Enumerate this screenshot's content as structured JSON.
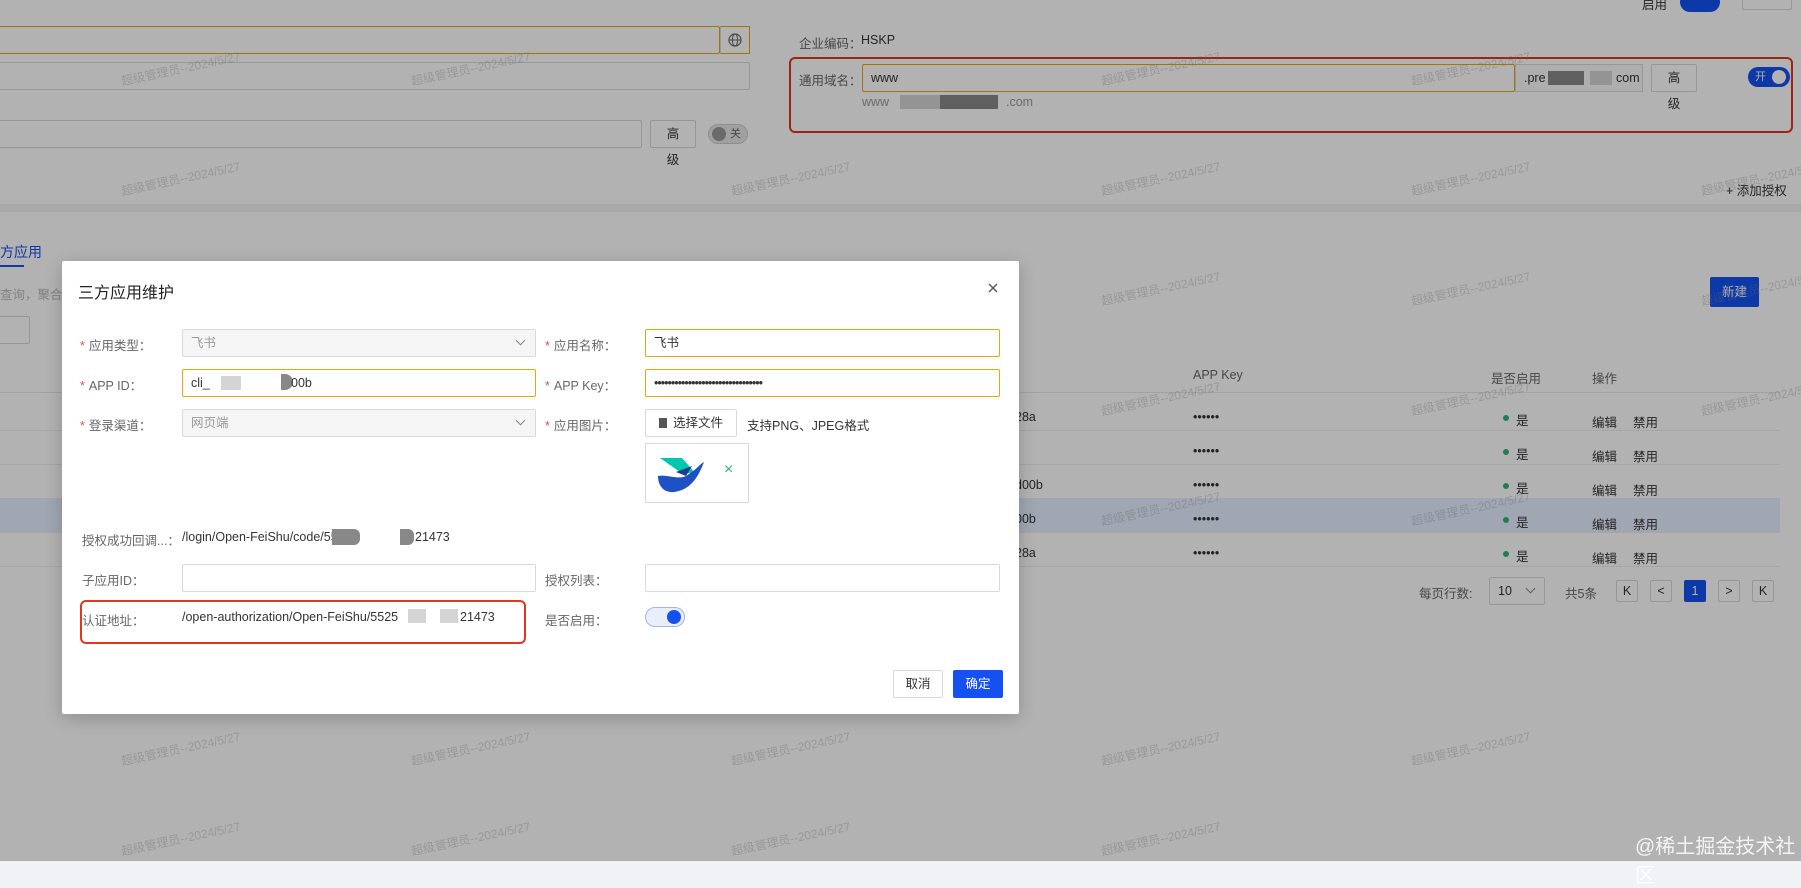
{
  "background": {
    "company_code_label": "企业编码：",
    "company_code_value": "HSKP",
    "domain_label": "通用域名：",
    "domain_input_value": "www",
    "domain_suffix_start": ".pre",
    "domain_suffix_end": "com",
    "advanced_label": "高级",
    "switch_on_text": "开",
    "switch_off_text": "关",
    "domain_preview_prefix": "www",
    "domain_preview_suffix": ".com",
    "add_auth_label": "添加授权",
    "section_tab": "方应用",
    "search_placeholder_partial": "查询，聚合查",
    "new_button": "新建",
    "table_headers": {
      "app_key": "APP Key",
      "enabled": "是否启用",
      "actions": "操作"
    },
    "rows": [
      {
        "app_id_tail": "28a",
        "app_key": "••••••",
        "enabled": "是",
        "edit": "编辑",
        "disable": "禁用"
      },
      {
        "app_id_tail": "",
        "app_key": "••••••",
        "enabled": "是",
        "edit": "编辑",
        "disable": "禁用"
      },
      {
        "app_id_tail": "d00b",
        "app_key": "••••••",
        "enabled": "是",
        "edit": "编辑",
        "disable": "禁用"
      },
      {
        "app_id_tail": "00b",
        "app_key": "••••••",
        "enabled": "是",
        "edit": "编辑",
        "disable": "禁用"
      },
      {
        "app_id_tail": "28a",
        "app_key": "••••••",
        "enabled": "是",
        "edit": "编辑",
        "disable": "禁用"
      }
    ],
    "pagination": {
      "per_page_label": "每页行数:",
      "per_page_value": "10",
      "total": "共5条",
      "current_page": "1"
    },
    "top_right_label": "启用",
    "watermark": "超级管理员--2024/5/27",
    "corner_watermark": "@稀土掘金技术社区"
  },
  "dialog": {
    "title": "三方应用维护",
    "close_icon": "close-icon",
    "app_type_label": "应用类型：",
    "app_type_value": "飞书",
    "app_name_label": "应用名称：",
    "app_name_value": "飞书",
    "app_id_label": "APP ID：",
    "app_id_prefix": "cli_",
    "app_id_suffix": "00b",
    "app_key_label": "APP Key：",
    "app_key_value": "••••••••••••••••••••••••••••••••",
    "login_channel_label": "登录渠道：",
    "login_channel_value": "网页端",
    "app_image_label": "应用图片：",
    "choose_file_label": "选择文件",
    "file_hint": "支持PNG、JPEG格式",
    "callback_label": "授权成功回调...：",
    "callback_prefix": "/login/Open-FeiShu/code/552",
    "callback_suffix": "21473",
    "sub_app_id_label": "子应用ID：",
    "auth_list_label": "授权列表：",
    "auth_url_label": "认证地址：",
    "auth_url_prefix": "/open-authorization/Open-FeiShu/5525",
    "auth_url_suffix": "21473",
    "enabled_label": "是否启用：",
    "cancel_label": "取消",
    "confirm_label": "确定"
  },
  "colors": {
    "primary": "#1451f0",
    "danger": "#e3361e",
    "focus_border": "#e6a817",
    "success": "#2bb673"
  }
}
